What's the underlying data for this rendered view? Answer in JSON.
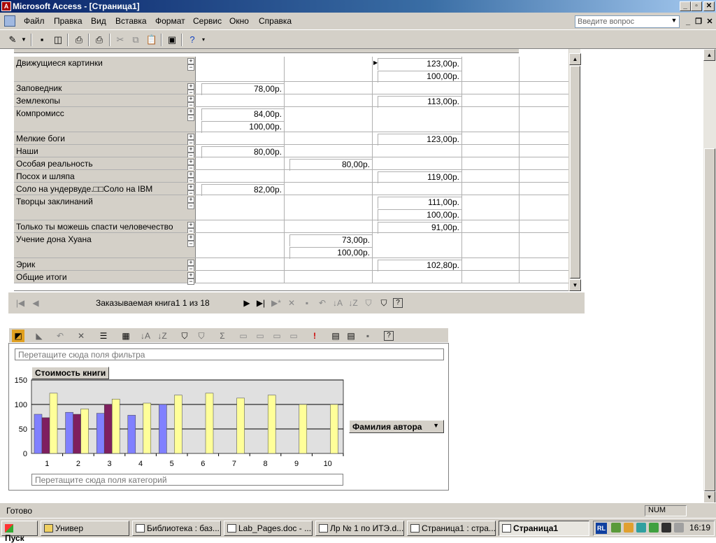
{
  "window": {
    "title": "Microsoft Access - [Страница1]",
    "minimize": "_",
    "maximize": "▫",
    "close": "✕"
  },
  "menu": {
    "items": [
      "Файл",
      "Правка",
      "Вид",
      "Вставка",
      "Формат",
      "Сервис",
      "Окно",
      "Справка"
    ],
    "ask_placeholder": "Введите вопрос"
  },
  "pivot": {
    "rows": [
      {
        "label": "Движущиеся картинки",
        "col1": [
          "",
          ""
        ],
        "col2": [
          "",
          ""
        ],
        "col3": [
          "123,00р.",
          "100,00р."
        ]
      },
      {
        "label": "Заповедник",
        "col1": [
          "78,00р."
        ],
        "col2": [
          ""
        ],
        "col3": [
          ""
        ]
      },
      {
        "label": "Землекопы",
        "col1": [
          ""
        ],
        "col2": [
          ""
        ],
        "col3": [
          "113,00р."
        ]
      },
      {
        "label": "Компромисс",
        "col1": [
          "84,00р.",
          "100,00р."
        ],
        "col2": [
          "",
          ""
        ],
        "col3": [
          "",
          ""
        ]
      },
      {
        "label": "Мелкие боги",
        "col1": [
          ""
        ],
        "col2": [
          ""
        ],
        "col3": [
          "123,00р."
        ]
      },
      {
        "label": "Наши",
        "col1": [
          "80,00р."
        ],
        "col2": [
          ""
        ],
        "col3": [
          ""
        ]
      },
      {
        "label": "Особая реальность",
        "col1": [
          ""
        ],
        "col2": [
          "80,00р."
        ],
        "col3": [
          ""
        ]
      },
      {
        "label": "Посох и шляпа",
        "col1": [
          ""
        ],
        "col2": [
          ""
        ],
        "col3": [
          "119,00р."
        ]
      },
      {
        "label": "Соло на ундервуде.□□Соло на IBM",
        "col1": [
          "82,00р."
        ],
        "col2": [
          ""
        ],
        "col3": [
          ""
        ]
      },
      {
        "label": "Творцы заклинаний",
        "col1": [
          "",
          ""
        ],
        "col2": [
          "",
          ""
        ],
        "col3": [
          "111,00р.",
          "100,00р."
        ]
      },
      {
        "label": "Только ты можешь спасти человечество",
        "col1": [
          ""
        ],
        "col2": [
          ""
        ],
        "col3": [
          "91,00р."
        ]
      },
      {
        "label": "Учение дона Хуана",
        "col1": [
          "",
          ""
        ],
        "col2": [
          "73,00р.",
          "100,00р."
        ],
        "col3": [
          "",
          ""
        ]
      },
      {
        "label": "Эрик",
        "col1": [
          ""
        ],
        "col2": [
          ""
        ],
        "col3": [
          "102,80р."
        ]
      },
      {
        "label": "Общие итоги",
        "col1": [
          ""
        ],
        "col2": [
          ""
        ],
        "col3": [
          ""
        ]
      }
    ]
  },
  "navigation": {
    "record_text": "Заказываемая книга1 1 из 18"
  },
  "chart_panel": {
    "filter_drop": "Перетащите сюда поля фильтра",
    "category_drop": "Перетащите сюда поля категорий",
    "value_field": "Стоимость книги",
    "series_field": "Фамилия автора"
  },
  "chart_data": {
    "type": "bar",
    "categories": [
      "1",
      "2",
      "3",
      "4",
      "5",
      "6",
      "7",
      "8",
      "9",
      "10"
    ],
    "ylim": [
      0,
      150
    ],
    "yticks": [
      "0",
      "50",
      "100",
      "150"
    ],
    "grid": true,
    "colors": [
      "#8080ff",
      "#7f1f5f",
      "#ffff99"
    ],
    "series": [
      {
        "values": [
          80,
          84,
          82,
          78,
          100,
          null,
          null,
          null,
          null,
          null
        ]
      },
      {
        "values": [
          73,
          80,
          100,
          null,
          null,
          null,
          null,
          null,
          null,
          null
        ]
      },
      {
        "values": [
          123,
          91,
          111,
          102.8,
          119,
          123,
          113,
          119,
          100,
          100
        ]
      }
    ]
  },
  "status": {
    "text": "Готово",
    "num": "NUM"
  },
  "taskbar": {
    "start": "Пуск",
    "tasks": [
      "Универ",
      "Библиотека : баз...",
      "Lab_Pages.doc - ...",
      "Лр № 1 по ИТЭ.d...",
      "Страница1 : стра...",
      "Страница1"
    ],
    "lang": "RL",
    "clock": "16:19"
  }
}
